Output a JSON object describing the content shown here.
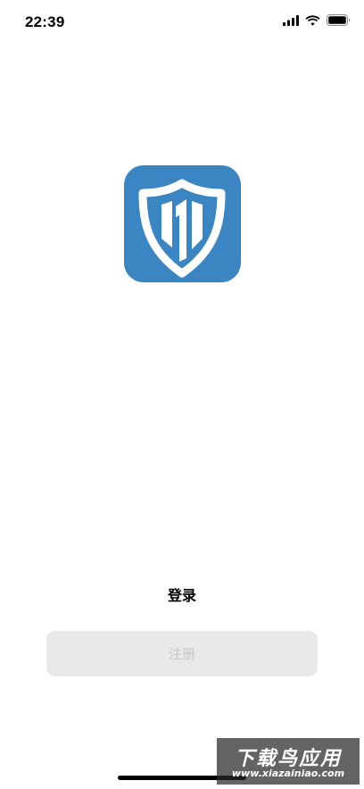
{
  "status_bar": {
    "time": "22:39",
    "icons": [
      "cellular-signal-icon",
      "wifi-icon",
      "battery-icon"
    ]
  },
  "logo": {
    "icon": "shield-logo-icon",
    "background_color": "#3b86c2"
  },
  "actions": {
    "login_label": "登录",
    "register_label": "注册"
  },
  "watermark": {
    "title": "下载鸟应用",
    "url": "www.xiazainiao.com"
  }
}
